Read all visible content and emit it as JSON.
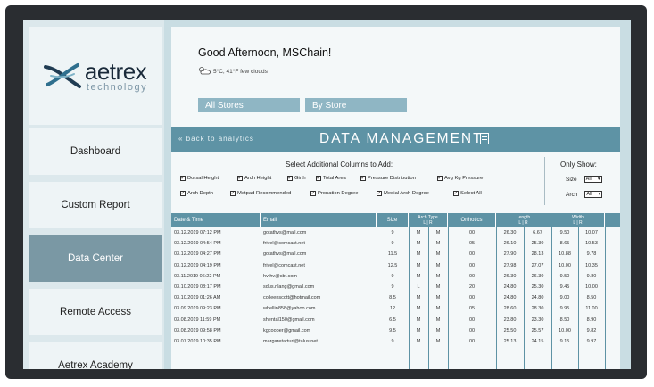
{
  "colors": {
    "accent": "#5e93a5",
    "active_nav": "#7a98a4",
    "tab": "#8fb6c4",
    "bezel": "#2a2d31"
  },
  "brand": {
    "name": "aetrex",
    "tagline": "technology"
  },
  "sidebar": {
    "items": [
      {
        "label": "Dashboard",
        "active": false
      },
      {
        "label": "Custom Report",
        "active": false
      },
      {
        "label": "Data Center",
        "active": true
      },
      {
        "label": "Remote Access",
        "active": false
      },
      {
        "label": "Aetrex Academy",
        "active": false
      }
    ]
  },
  "header": {
    "greeting": "Good Afternoon, MSChain!",
    "weather": "5°C, 41°F few clouds",
    "weather_icon": "cloud-sun-icon"
  },
  "store_tabs": [
    "All Stores",
    "By Store"
  ],
  "data_management": {
    "back": "« back to analytics",
    "title": "DATA MANAGEMENT",
    "icon": "document-icon"
  },
  "columns_select": {
    "title": "Select Additional Columns to Add:",
    "options": [
      "Dorsal Height",
      "Arch Height",
      "Girth",
      "Total Area",
      "Pressure Distribution",
      "Avg Kg Pressure",
      "Arch Depth",
      "Metpad Recommended",
      "Pronation Degree",
      "Medial Arch Degree",
      "Select All"
    ]
  },
  "filters": {
    "title": "Only Show:",
    "size_label": "Size",
    "size_value": "All",
    "arch_label": "Arch",
    "arch_value": "All"
  },
  "table": {
    "headers": [
      "Date & Time",
      "Email",
      "Size",
      "Arch Type",
      "Orthotics",
      "Length",
      "Width"
    ],
    "sub_headers": {
      "arch": "L | R",
      "length": "L | R",
      "width": "L | R"
    },
    "rows": [
      [
        "03.12.2019 07:12 PM",
        "gotathvs@mail.com",
        "9",
        "M",
        "M",
        "00",
        "26.30",
        "6.67",
        "9.50",
        "10.07"
      ],
      [
        "03.12.2019 04:54 PM",
        "frivel@comcast.net",
        "9",
        "M",
        "M",
        "05",
        "26.10",
        "25.30",
        "8.65",
        "10.53"
      ],
      [
        "03.12.2019 04:27 PM",
        "gotathvs@mail.com",
        "11.5",
        "M",
        "M",
        "00",
        "27.90",
        "28.13",
        "10.88",
        "9.78"
      ],
      [
        "03.12.2019 04:19 PM",
        "frivel@comcast.net",
        "12.5",
        "M",
        "M",
        "00",
        "27.98",
        "27.07",
        "10.00",
        "10.35"
      ],
      [
        "03.11.2019 06:22 PM",
        "hvthv@sbf.com",
        "9",
        "M",
        "M",
        "00",
        "26.30",
        "26.30",
        "9.50",
        "9.80"
      ],
      [
        "03.10.2019 08:17 PM",
        "sdus.nlang@gmail.com",
        "9",
        "L",
        "M",
        "20",
        "24.80",
        "25.30",
        "9.45",
        "10.00"
      ],
      [
        "03.10.2019 01:26 AM",
        "colleenscott@hotmail.com",
        "8.5",
        "M",
        "M",
        "00",
        "24.80",
        "24.80",
        "9.00",
        "8.50"
      ],
      [
        "03.09.2019 09:23 PM",
        "wbellin858@yahoo.com",
        "12",
        "M",
        "M",
        "05",
        "28.60",
        "28.30",
        "9.95",
        "11.00"
      ],
      [
        "03.08.2019 11:59 PM",
        "shental150@gmail.com",
        "6.5",
        "M",
        "M",
        "00",
        "23.80",
        "23.30",
        "8.50",
        "8.90"
      ],
      [
        "03.08.2019 09:58 PM",
        "kgcooper@gmail.com",
        "9.5",
        "M",
        "M",
        "00",
        "25.50",
        "25.57",
        "10.00",
        "9.82"
      ],
      [
        "03.07.2019 10:35 PM",
        "margaretarturi@talus.net",
        "9",
        "M",
        "M",
        "00",
        "25.13",
        "24.15",
        "9.15",
        "9.97"
      ]
    ]
  }
}
